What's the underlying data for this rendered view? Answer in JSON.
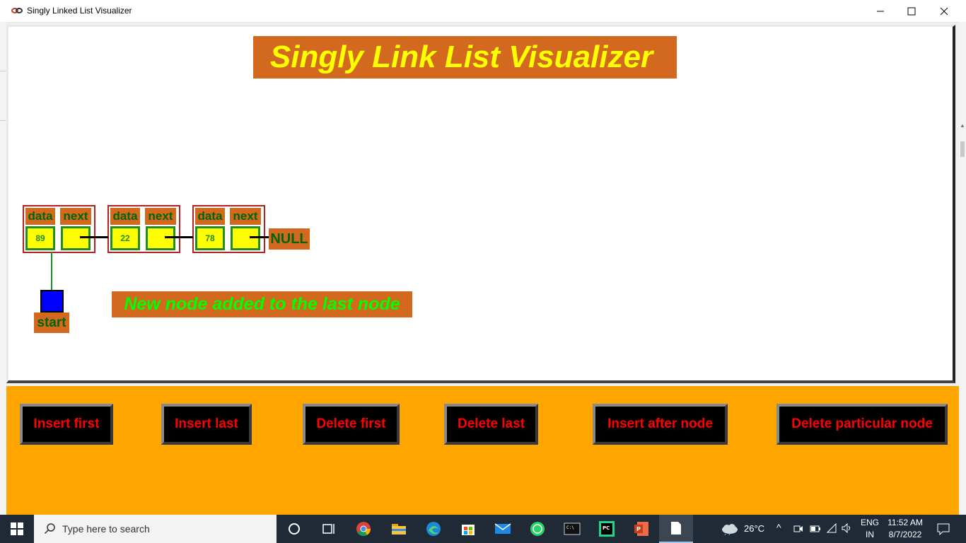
{
  "window": {
    "title": "Singly Linked List Visualizer"
  },
  "canvas": {
    "heading": "Singly Link List Visualizer",
    "labels": {
      "data": "data",
      "next": "next"
    },
    "nodes": [
      {
        "value": "89"
      },
      {
        "value": "22"
      },
      {
        "value": "78"
      }
    ],
    "null_label": "NULL",
    "start_label": "start",
    "message": "New node added to the last node"
  },
  "buttons": {
    "insert_first": "Insert first",
    "insert_last": "Insert last",
    "delete_first": "Delete first",
    "delete_last": "Delete last",
    "insert_after": "Insert after node",
    "delete_particular": "Delete particular node"
  },
  "taskbar": {
    "search_placeholder": "Type here to search",
    "weather": "26°C",
    "lang_1": "ENG",
    "lang_2": "IN",
    "time": "11:52 AM",
    "date": "8/7/2022"
  },
  "colors": {
    "accent_orange": "#d2691e",
    "panel_orange": "#ffa500",
    "button_text": "#ff0000",
    "title_text": "#ffff00"
  }
}
